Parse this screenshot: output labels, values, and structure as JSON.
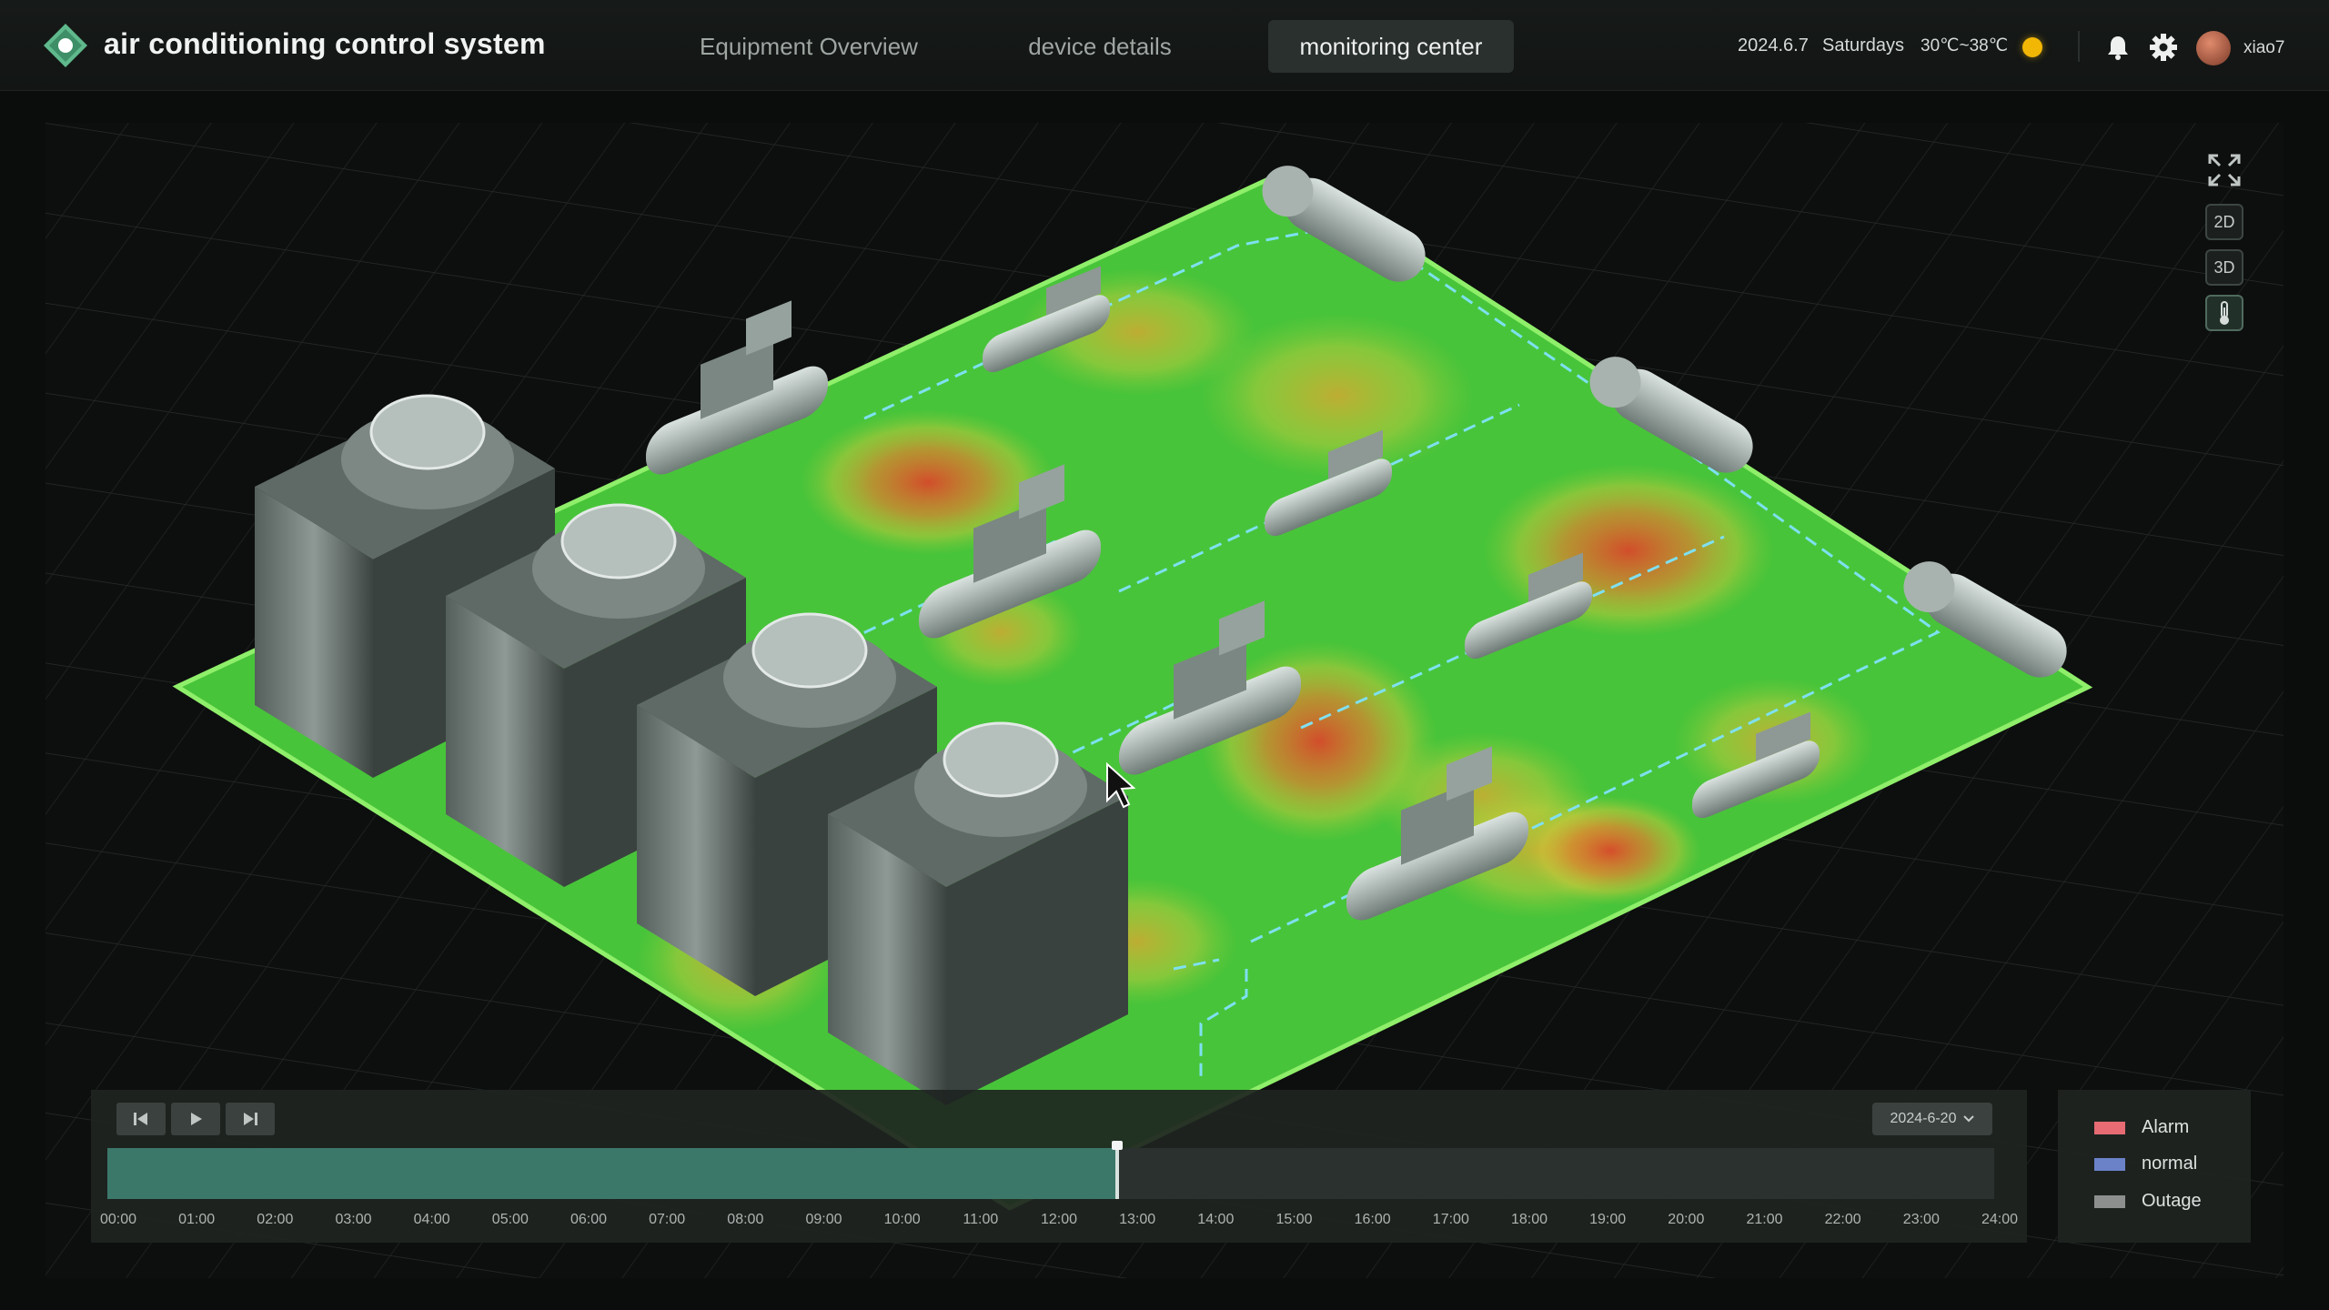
{
  "header": {
    "title": "air conditioning control system",
    "nav": [
      {
        "label": "Equipment Overview",
        "active": false
      },
      {
        "label": "device details",
        "active": false
      },
      {
        "label": "monitoring center",
        "active": true
      }
    ],
    "date": "2024.6.7",
    "weekday": "Saturdays",
    "temperature": "30℃~38℃",
    "weather_icon": "sun-icon",
    "username": "xiao7"
  },
  "view_tools": {
    "fullscreen_icon": "fullscreen-icon",
    "mode_2d": "2D",
    "mode_3d": "3D",
    "thermometer_icon": "thermometer-icon"
  },
  "timeline": {
    "selected_date": "2024-6-20",
    "progress_fraction": 0.535,
    "ticks": [
      "00:00",
      "01:00",
      "02:00",
      "03:00",
      "04:00",
      "05:00",
      "06:00",
      "07:00",
      "08:00",
      "09:00",
      "10:00",
      "11:00",
      "12:00",
      "13:00",
      "14:00",
      "15:00",
      "16:00",
      "17:00",
      "18:00",
      "19:00",
      "20:00",
      "21:00",
      "22:00",
      "23:00",
      "24:00"
    ]
  },
  "legend": [
    {
      "label": "Alarm",
      "color": "#e66b73"
    },
    {
      "label": "normal",
      "color": "#6b82c9"
    },
    {
      "label": "Outage",
      "color": "#8c8f8d"
    }
  ],
  "colors": {
    "accent": "#3c7869",
    "floor": "#4fc23a",
    "heat_hot": "#d9472a",
    "pipe": "#7fe0f0"
  }
}
